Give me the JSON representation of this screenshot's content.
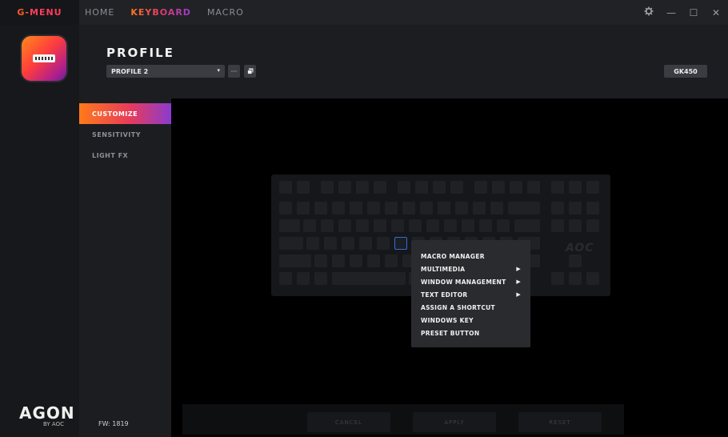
{
  "nav": {
    "brand_g": "G-",
    "brand_menu": "MENU",
    "tabs": [
      {
        "label": "HOME"
      },
      {
        "label": "KEYBOARD"
      },
      {
        "label": "MACRO"
      }
    ],
    "active_tab": "KEYBOARD"
  },
  "window": {
    "settings_icon": "gear-icon",
    "minimize_glyph": "—",
    "maximize_glyph": "☐",
    "close_glyph": "✕"
  },
  "profile": {
    "title": "PROFILE",
    "selected": "PROFILE 2",
    "caret": "▾",
    "more_glyph": "···",
    "device": "GK450"
  },
  "subnav": {
    "items": [
      {
        "label": "CUSTOMIZE"
      },
      {
        "label": "SENSITIVITY"
      },
      {
        "label": "LIGHT FX"
      }
    ],
    "active": "CUSTOMIZE"
  },
  "firmware": "FW: 1819",
  "branding": {
    "agon": "AGON",
    "by_aoc": "BY AOC",
    "keyboard_logo": "AOC"
  },
  "context_menu": {
    "items": [
      {
        "label": "MACRO MANAGER",
        "submenu": false
      },
      {
        "label": "MULTIMEDIA",
        "submenu": true
      },
      {
        "label": "WINDOW MANAGEMENT",
        "submenu": true
      },
      {
        "label": "TEXT EDITOR",
        "submenu": true
      },
      {
        "label": "ASSIGN A SHORTCUT",
        "submenu": false
      },
      {
        "label": "WINDOWS KEY",
        "submenu": false
      },
      {
        "label": "PRESET BUTTON",
        "submenu": false
      }
    ],
    "submenu_arrow": "▶"
  },
  "actions": {
    "cancel": "CANCEL",
    "apply": "APPLY",
    "reset": "RESET"
  },
  "colors": {
    "accent_orange": "#ff7a1a",
    "accent_magenta": "#e83b5a",
    "accent_purple": "#8a3bd0",
    "selected_key_outline": "#2e6fd6"
  }
}
